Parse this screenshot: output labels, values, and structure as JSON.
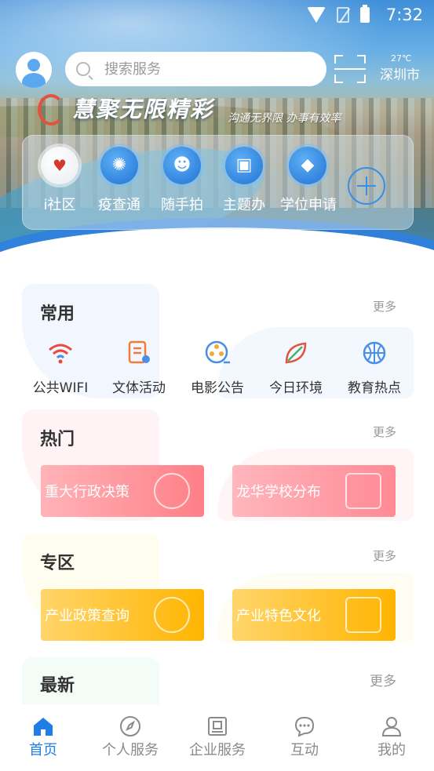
{
  "status_bar": {
    "time": "7:32"
  },
  "header": {
    "search_placeholder": "搜索服务",
    "weather": {
      "temperature": "27℃",
      "city": "深圳市"
    }
  },
  "banner": {
    "title": "慧聚无限精彩",
    "subtitle": "沟通无界限 办事有效率"
  },
  "quick_services": [
    {
      "label": "i社区",
      "icon": "community-heart-icon"
    },
    {
      "label": "疫查通",
      "icon": "virus-check-icon"
    },
    {
      "label": "随手拍",
      "icon": "camera-person-icon"
    },
    {
      "label": "主题办",
      "icon": "briefcase-icon"
    },
    {
      "label": "学位申请",
      "icon": "graduation-cap-icon"
    }
  ],
  "common": {
    "title": "常用",
    "more": "更多",
    "items": [
      {
        "label": "公共WIFI",
        "icon": "wifi-icon",
        "color": "#e84a3f"
      },
      {
        "label": "文体活动",
        "icon": "document-list-icon",
        "color": "#f07a3a"
      },
      {
        "label": "电影公告",
        "icon": "film-reel-icon",
        "color": "#f2a93b"
      },
      {
        "label": "今日环境",
        "icon": "leaf-icon",
        "color": "#e5533f"
      },
      {
        "label": "教育热点",
        "icon": "basketball-icon",
        "color": "#4a8fe6"
      }
    ]
  },
  "hot": {
    "title": "热门",
    "more": "更多",
    "cards": [
      {
        "label": "重大行政决策",
        "icon": "gear-icon"
      },
      {
        "label": "龙华学校分布",
        "icon": "school-map-icon"
      }
    ]
  },
  "zone": {
    "title": "专区",
    "more": "更多",
    "cards": [
      {
        "label": "产业政策查询",
        "icon": "coin-stack-icon"
      },
      {
        "label": "产业特色文化",
        "icon": "scale-icon"
      }
    ]
  },
  "latest": {
    "title": "最新",
    "more": "更多"
  },
  "tabs": [
    {
      "label": "首页",
      "icon": "home-icon",
      "active": true
    },
    {
      "label": "个人服务",
      "icon": "compass-icon",
      "active": false
    },
    {
      "label": "企业服务",
      "icon": "building-icon",
      "active": false
    },
    {
      "label": "互动",
      "icon": "chat-bubble-icon",
      "active": false
    },
    {
      "label": "我的",
      "icon": "user-icon",
      "active": false
    }
  ],
  "colors": {
    "accent": "#1f7de6",
    "hot_card": "#ff7f87",
    "zone_card": "#ffb400"
  }
}
